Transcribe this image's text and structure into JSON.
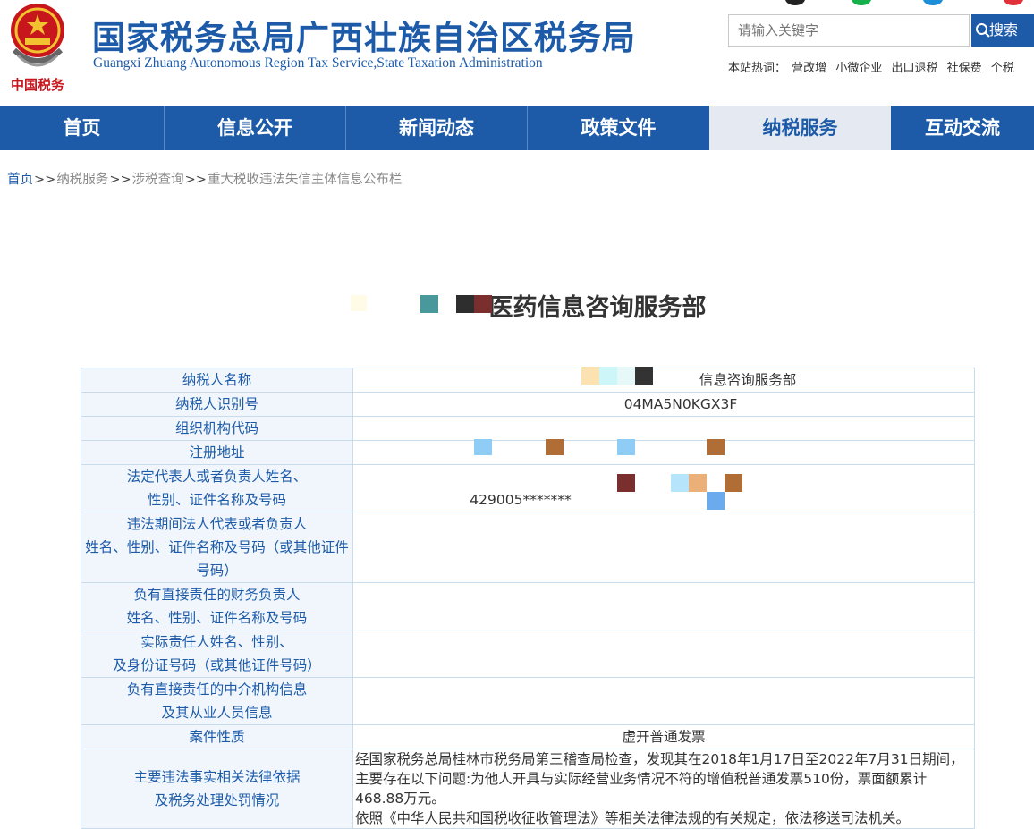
{
  "header": {
    "site_title_cn": "国家税务总局广西壮族自治区税务局",
    "site_title_en": "Guangxi Zhuang Autonomous Region Tax Service,State Taxation Administration",
    "emblem_text": "中国税务",
    "search": {
      "placeholder": "请输入关键字",
      "button_label": "搜索"
    },
    "hot_words": {
      "label": "本站热词：",
      "items": [
        "营改增",
        "小微企业",
        "出口退税",
        "社保费",
        "个税"
      ]
    }
  },
  "nav": {
    "items": [
      "首页",
      "信息公开",
      "新闻动态",
      "政策文件",
      "纳税服务",
      "互动交流"
    ],
    "active": "纳税服务"
  },
  "breadcrumb": {
    "items": [
      "首页",
      "纳税服务",
      "涉税查询",
      "重大税收违法失信主体信息公布栏"
    ],
    "separator": ">>"
  },
  "page_title": "医药信息咨询服务部",
  "table": {
    "rows": [
      {
        "label": "纳税人名称",
        "value": "信息咨询服务部"
      },
      {
        "label": "纳税人识别号",
        "value": "04MA5N0KGX3F"
      },
      {
        "label": "组织机构代码",
        "value": ""
      },
      {
        "label": "注册地址",
        "value": ""
      },
      {
        "label": "法定代表人或者负责人姓名、\n性别、证件名称及号码",
        "value": "429005*******"
      },
      {
        "label": "违法期间法人代表或者负责人\n姓名、性别、证件名称及号码（或其他证件号码）",
        "value": ""
      },
      {
        "label": "负有直接责任的财务负责人\n姓名、性别、证件名称及号码",
        "value": ""
      },
      {
        "label": "实际责任人姓名、性别、\n及身份证号码（或其他证件号码）",
        "value": ""
      },
      {
        "label": "负有直接责任的中介机构信息\n及其从业人员信息",
        "value": ""
      },
      {
        "label": "案件性质",
        "value": "虚开普通发票"
      },
      {
        "label": "主要违法事实相关法律依据\n及税务处理处罚情况",
        "value": "经国家税务总局桂林市税务局第三稽查局检查，发现其在2018年1月17日至2022年7月31日期间，主要存在以下问题:为他人开具与实际经营业务情况不符的增值税普通发票510份，票面额累计468.88万元。\n依照《中华人民共和国税收征收管理法》等相关法律法规的有关规定，依法移送司法机关。"
      }
    ]
  },
  "colors": {
    "brand_blue": "#1d5ba8",
    "nav_active_bg": "#e4e9f2",
    "table_border": "#c8dcec",
    "label_bg": "#f0f6fc",
    "emblem_red": "#c8161d"
  }
}
